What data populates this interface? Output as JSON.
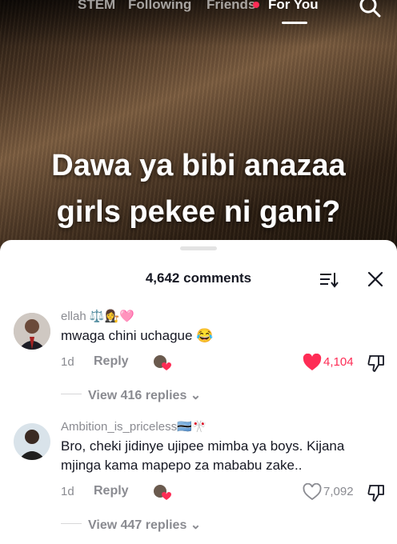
{
  "top_nav": {
    "tabs": [
      {
        "label": "STEM"
      },
      {
        "label": "Following"
      },
      {
        "label": "Friends"
      },
      {
        "label": "For You"
      }
    ]
  },
  "video": {
    "caption_line1": "Dawa ya bibi anazaa",
    "caption_line2": "girls pekee ni gani?"
  },
  "comments_sheet": {
    "title": "4,642 comments",
    "comments": [
      {
        "username": "ellah ⚖️👩‍⚖️🩷",
        "text": "mwaga chini uchague 😂",
        "age": "1d",
        "reply_label": "Reply",
        "likes": "4,104",
        "liked": true,
        "view_replies": "View 416 replies"
      },
      {
        "username": "Ambition_is_priceless🇧🇼🎌",
        "text": "Bro, cheki jidinye ujipee mimba ya boys. Kijana mjinga kama mapepo za mababu zake..",
        "age": "1d",
        "reply_label": "Reply",
        "likes": "7,092",
        "liked": false,
        "view_replies": "View 447 replies"
      }
    ]
  },
  "colors": {
    "accent": "#fe2c55",
    "text_primary": "#161823",
    "text_secondary": "#8a8b91"
  }
}
